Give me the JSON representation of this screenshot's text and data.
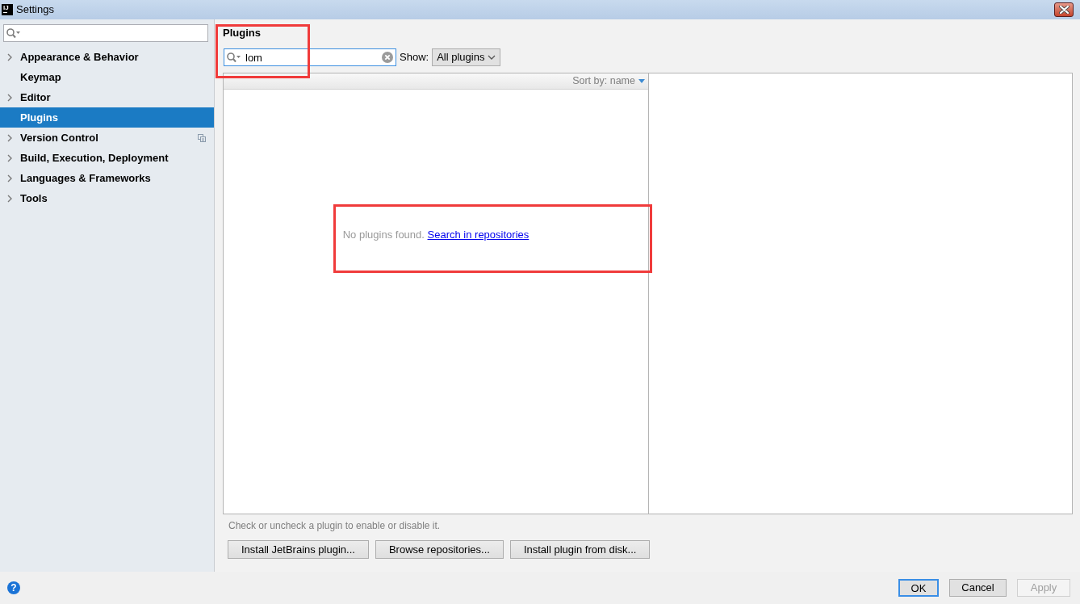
{
  "window": {
    "logo": "IJ",
    "title": "Settings"
  },
  "sidebar": {
    "items": [
      {
        "label": "Appearance & Behavior",
        "expandable": true,
        "selected": false,
        "project_level": false
      },
      {
        "label": "Keymap",
        "expandable": false,
        "selected": false,
        "project_level": false
      },
      {
        "label": "Editor",
        "expandable": true,
        "selected": false,
        "project_level": false
      },
      {
        "label": "Plugins",
        "expandable": false,
        "selected": true,
        "project_level": false
      },
      {
        "label": "Version Control",
        "expandable": true,
        "selected": false,
        "project_level": true
      },
      {
        "label": "Build, Execution, Deployment",
        "expandable": true,
        "selected": false,
        "project_level": false
      },
      {
        "label": "Languages & Frameworks",
        "expandable": true,
        "selected": false,
        "project_level": false
      },
      {
        "label": "Tools",
        "expandable": true,
        "selected": false,
        "project_level": false
      }
    ]
  },
  "plugins": {
    "title": "Plugins",
    "search": {
      "value": "lom",
      "focused": true,
      "highlighted": true
    },
    "show_label": "Show:",
    "show_filter": {
      "value": "All plugins"
    },
    "sort_control": "Sort by: name",
    "empty_state": {
      "message": "No plugins found.",
      "link": "Search in repositories",
      "highlighted": true
    },
    "hint": "Check or uncheck a plugin to enable or disable it.",
    "buttons": [
      "Install JetBrains plugin...",
      "Browse repositories...",
      "Install plugin from disk..."
    ]
  },
  "footer": {
    "help": "?",
    "buttons": [
      {
        "label": "OK",
        "default": true,
        "disabled": false
      },
      {
        "label": "Cancel",
        "default": false,
        "disabled": false
      },
      {
        "label": "Apply",
        "default": false,
        "disabled": true
      }
    ]
  }
}
